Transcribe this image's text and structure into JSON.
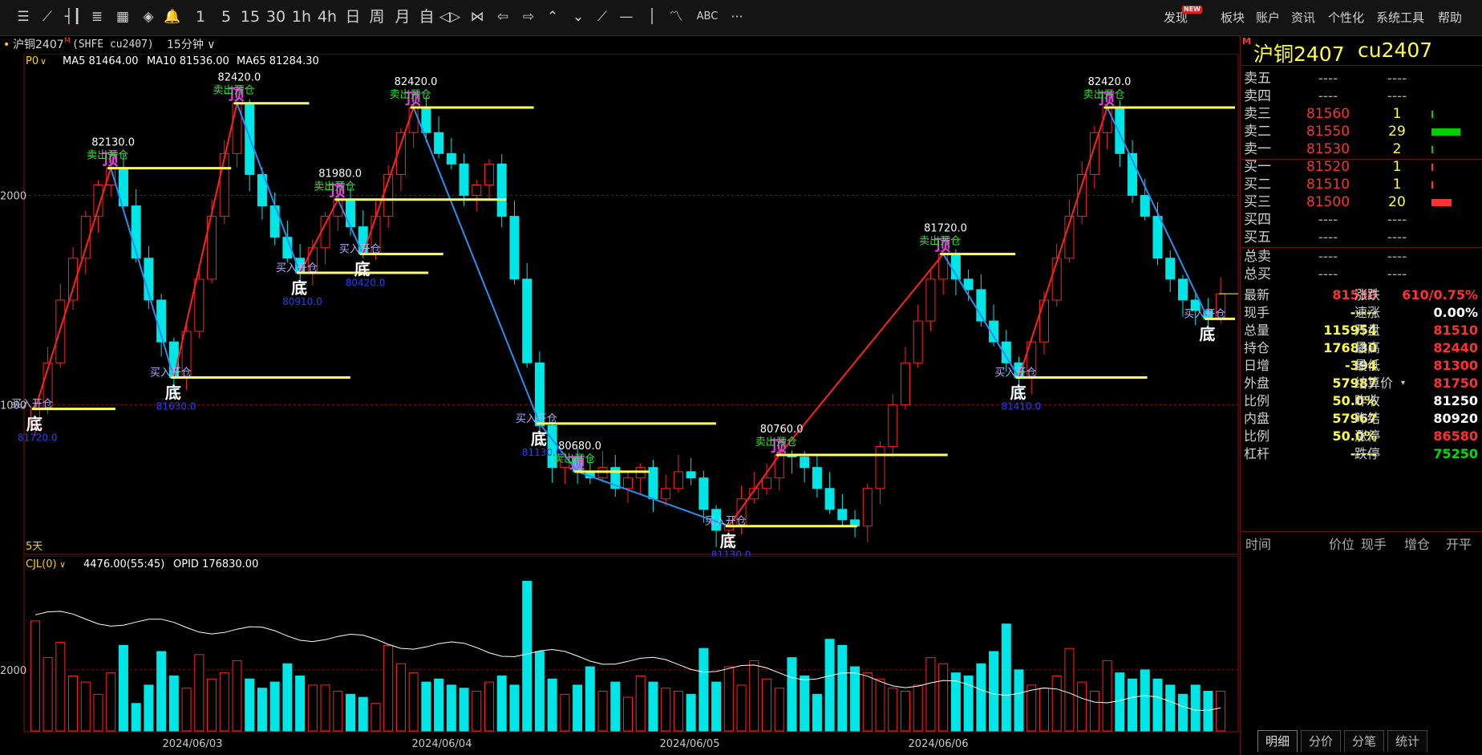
{
  "toolbar": {
    "icons": [
      "menu-icon",
      "line-chart-icon",
      "candle-icon",
      "kline-icon",
      "grid-icon",
      "network-icon",
      "bell-icon"
    ],
    "periods": [
      "1",
      "5",
      "15",
      "30",
      "1h",
      "4h",
      "日",
      "周",
      "月",
      "自"
    ],
    "draw_labels": {
      "abc": "ABC",
      "more": "···"
    },
    "right_menu": [
      "发现",
      "板块",
      "账户",
      "资讯",
      "个性化",
      "系统工具",
      "帮助"
    ],
    "new_badge": "NEW"
  },
  "infobar": {
    "dot": "•",
    "name": "沪铜2407",
    "superscript": "M",
    "code": "(SHFE  cu2407)",
    "period": "15分钟"
  },
  "main": {
    "indicator_label": "P0",
    "ma": [
      {
        "label": "MA5 81464.00",
        "color": "#ffffff"
      },
      {
        "label": "MA10 81536.00",
        "color": "#ffffff"
      },
      {
        "label": "MA65 81284.30",
        "color": "#ffffff"
      }
    ],
    "y_ticks": [
      {
        "label": "2000",
        "value": 82000
      },
      {
        "label": "1000",
        "value": 81000
      }
    ],
    "range_label": "5天"
  },
  "volume": {
    "indicator_label": "CJL(0)",
    "values_label": "4476.00(55:45)",
    "opid_label": "OPID 176830.00",
    "y_tick": "2000"
  },
  "dates": [
    "2024/06/03",
    "2024/06/04",
    "2024/06/05",
    "2024/06/06"
  ],
  "chart_annotations": {
    "price_labels": [
      "82130.0",
      "82420.0",
      "81980.0",
      "82420.0",
      "80680.0",
      "80760.0",
      "81720.0",
      "82420.0"
    ],
    "top_label": "顶",
    "bottom_label": "底",
    "sell_open": "卖出开仓",
    "buy_open": "买入开仓",
    "small_blue_labels": [
      "81720.0",
      "81630.0",
      "80910.0",
      "80420.0",
      "81130.0",
      "81130.0",
      "81410.0"
    ]
  },
  "chart_data": {
    "type": "candlestick",
    "title": "沪铜2407 15分钟",
    "series": [
      {
        "name": "MA5",
        "value": 81464.0
      },
      {
        "name": "MA10",
        "value": 81536.0
      },
      {
        "name": "MA65",
        "value": 81284.3
      }
    ],
    "swing_points": [
      {
        "kind": "底",
        "price": 80980
      },
      {
        "kind": "顶",
        "price": 82130
      },
      {
        "kind": "底",
        "price": 81130
      },
      {
        "kind": "顶",
        "price": 82440
      },
      {
        "kind": "底",
        "price": 81630
      },
      {
        "kind": "顶",
        "price": 81980
      },
      {
        "kind": "底",
        "price": 81720
      },
      {
        "kind": "顶",
        "price": 82420
      },
      {
        "kind": "底",
        "price": 80910
      },
      {
        "kind": "顶",
        "price": 80680
      },
      {
        "kind": "底",
        "price": 80420
      },
      {
        "kind": "顶",
        "price": 80760
      },
      {
        "kind": "顶",
        "price": 81720
      },
      {
        "kind": "底",
        "price": 81130
      },
      {
        "kind": "顶",
        "price": 82420
      },
      {
        "kind": "底",
        "price": 81410
      }
    ],
    "close_series": [
      80980,
      81200,
      81500,
      81700,
      81900,
      82050,
      82130,
      81950,
      81700,
      81500,
      81300,
      81130,
      81350,
      81600,
      81900,
      82200,
      82440,
      82100,
      81950,
      81800,
      81700,
      81630,
      81750,
      81900,
      81980,
      81850,
      81720,
      81900,
      82100,
      82300,
      82420,
      82300,
      82200,
      82150,
      82000,
      82050,
      82150,
      81900,
      81600,
      81200,
      80900,
      80700,
      80750,
      80680,
      80650,
      80700,
      80600,
      80650,
      80700,
      80550,
      80600,
      80680,
      80650,
      80500,
      80400,
      80420,
      80550,
      80600,
      80650,
      80760,
      80750,
      80700,
      80600,
      80500,
      80450,
      80420,
      80600,
      80800,
      81000,
      81200,
      81400,
      81600,
      81720,
      81600,
      81550,
      81400,
      81300,
      81200,
      81130,
      81300,
      81500,
      81700,
      81900,
      82100,
      82300,
      82420,
      82200,
      82000,
      81900,
      81700,
      81600,
      81500,
      81450,
      81410,
      81530
    ],
    "volume_series": [
      3600,
      2400,
      2900,
      1800,
      1600,
      1200,
      1900,
      2800,
      900,
      1500,
      2600,
      1800,
      1400,
      2500,
      1700,
      1900,
      2300,
      1700,
      1400,
      1600,
      2200,
      1800,
      1500,
      1500,
      1300,
      1200,
      1100,
      900,
      2800,
      2200,
      1900,
      1600,
      1700,
      1500,
      1400,
      1300,
      1600,
      1800,
      1500,
      4900,
      2600,
      1700,
      1200,
      1500,
      2100,
      1300,
      1600,
      1100,
      1800,
      1600,
      1400,
      1300,
      1200,
      2700,
      1600,
      2100,
      1500,
      2300,
      1700,
      1400,
      2400,
      1800,
      1200,
      3000,
      2800,
      2100,
      1900,
      1700,
      1400,
      1300,
      1500,
      2400,
      2200,
      1900,
      1800,
      2200,
      2600,
      3500,
      2000,
      1500,
      1400,
      1800,
      2700,
      1600,
      1300,
      2300,
      1900,
      1700,
      2000,
      1700,
      1500,
      1200,
      1500,
      1300,
      1300
    ],
    "y_range": [
      80300,
      82600
    ]
  },
  "right_panel": {
    "title": "沪铜2407",
    "code": "cu2407",
    "corner": "M",
    "book": [
      {
        "label": "卖五",
        "price": "----",
        "vol": "----",
        "bar": 0,
        "bar_color": "#00d000"
      },
      {
        "label": "卖四",
        "price": "----",
        "vol": "----",
        "bar": 0,
        "bar_color": "#00d000"
      },
      {
        "label": "卖三",
        "price": "81560",
        "vol": "1",
        "bar": 0.04,
        "bar_color": "#00d000"
      },
      {
        "label": "卖二",
        "price": "81550",
        "vol": "29",
        "bar": 1.0,
        "bar_color": "#00d000"
      },
      {
        "label": "卖一",
        "price": "81530",
        "vol": "2",
        "bar": 0.06,
        "bar_color": "#00d000"
      },
      {
        "label": "买一",
        "price": "81520",
        "vol": "1",
        "bar": 0.04,
        "bar_color": "#ff3030"
      },
      {
        "label": "买二",
        "price": "81510",
        "vol": "1",
        "bar": 0.04,
        "bar_color": "#ff3030"
      },
      {
        "label": "买三",
        "price": "81500",
        "vol": "20",
        "bar": 0.69,
        "bar_color": "#ff3030"
      },
      {
        "label": "买四",
        "price": "----",
        "vol": "----",
        "bar": 0,
        "bar_color": "#ff3030"
      },
      {
        "label": "买五",
        "price": "----",
        "vol": "----",
        "bar": 0,
        "bar_color": "#ff3030"
      },
      {
        "label": "总卖",
        "price": "----",
        "vol": "----",
        "bar": 0,
        "bar_color": "#00d000"
      },
      {
        "label": "总买",
        "price": "----",
        "vol": "----",
        "bar": 0,
        "bar_color": "#ff3030"
      }
    ],
    "stats": [
      {
        "l": "最新",
        "v": "81530",
        "c": "#ff3030",
        "l2": "涨跌",
        "v2": "610/0.75%",
        "c2": "#ff3030"
      },
      {
        "l": "现手",
        "v": "-----",
        "c": "#ffff40",
        "l2": "速涨",
        "v2": "0.00%",
        "c2": "#ffffff"
      },
      {
        "l": "总量",
        "v": "115954",
        "c": "#ffff40",
        "l2": "开盘",
        "v2": "81510",
        "c2": "#ff3030"
      },
      {
        "l": "持仓",
        "v": "176830",
        "c": "#ffff40",
        "l2": "最高",
        "v2": "82440",
        "c2": "#ff3030"
      },
      {
        "l": "日增",
        "v": "-394",
        "c": "#ffff40",
        "l2": "最低",
        "v2": "81300",
        "c2": "#ff3030"
      },
      {
        "l": "外盘",
        "v": "57987",
        "c": "#ffff40",
        "l2": "结算价",
        "v2": "81750",
        "c2": "#ff3030"
      },
      {
        "l": "比例",
        "v": "50.0%",
        "c": "#ffff40",
        "l2": "昨收",
        "v2": "81250",
        "c2": "#ffffff"
      },
      {
        "l": "内盘",
        "v": "57967",
        "c": "#ffff40",
        "l2": "昨结",
        "v2": "80920",
        "c2": "#ffffff"
      },
      {
        "l": "比例",
        "v": "50.0%",
        "c": "#ffff40",
        "l2": "涨停",
        "v2": "86580",
        "c2": "#ff3030"
      },
      {
        "l": "杠杆",
        "v": "-----",
        "c": "#ffff40",
        "l2": "跌停",
        "v2": "75250",
        "c2": "#00e000"
      }
    ],
    "trade_headers": [
      "时间",
      "价位",
      "现手",
      "增仓",
      "开平"
    ],
    "tabs": [
      "明细",
      "分价",
      "分笔",
      "统计"
    ]
  }
}
